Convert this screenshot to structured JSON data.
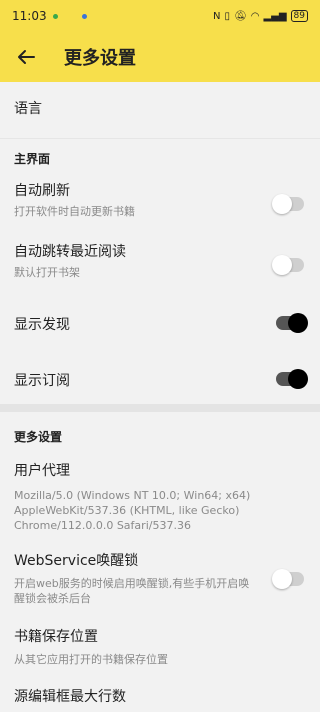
{
  "status_bar": {
    "time": "11:03",
    "battery": "89",
    "icons": [
      "nfc-icon",
      "vibrate-icon",
      "mute-icon",
      "wifi-icon",
      "signal-icon"
    ]
  },
  "appbar": {
    "title": "更多设置",
    "accent": "#f7df4b"
  },
  "settings": {
    "language": {
      "label": "语言"
    },
    "main_section": "主界面",
    "auto_refresh": {
      "label": "自动刷新",
      "summary": "打开软件时自动更新书籍",
      "on": false
    },
    "auto_jump": {
      "label": "自动跳转最近阅读",
      "summary": "默认打开书架",
      "on": false
    },
    "show_discover": {
      "label": "显示发现",
      "on": true
    },
    "show_subscribe": {
      "label": "显示订阅",
      "on": true
    },
    "more_section": "更多设置",
    "user_agent": {
      "label": "用户代理",
      "summary": "Mozilla/5.0 (Windows NT 10.0; Win64; x64) AppleWebKit/537.36 (KHTML, like Gecko) Chrome/112.0.0.0 Safari/537.36"
    },
    "web_wakelock": {
      "label": "WebService唤醒锁",
      "summary": "开启web服务的时候启用唤醒锁,有些手机开启唤醒锁会被杀后台",
      "on": false
    },
    "book_save": {
      "label": "书籍保存位置",
      "summary": "从其它应用打开的书籍保存位置"
    },
    "source_edit_lines": {
      "label": "源编辑框最大行数"
    }
  }
}
